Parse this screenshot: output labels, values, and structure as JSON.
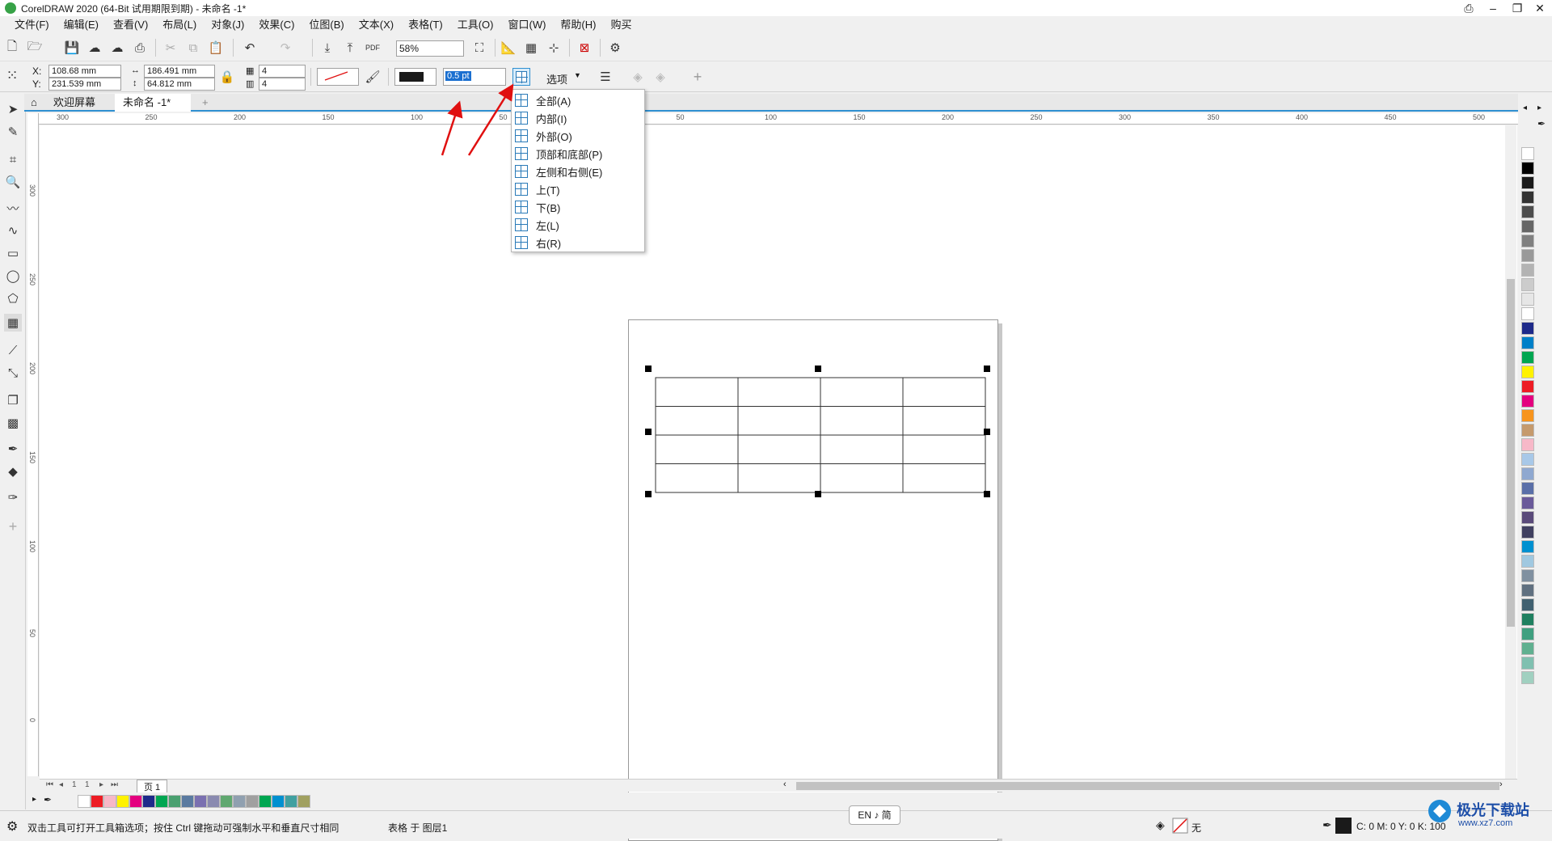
{
  "window": {
    "title": "CorelDRAW 2020 (64-Bit 试用期限到期) - 未命名 -1*",
    "minimize": "–",
    "maximize": "❐",
    "close": "✕"
  },
  "menu": [
    "文件(F)",
    "编辑(E)",
    "查看(V)",
    "布局(L)",
    "对象(J)",
    "效果(C)",
    "位图(B)",
    "文本(X)",
    "表格(T)",
    "工具(O)",
    "窗口(W)",
    "帮助(H)",
    "购买"
  ],
  "standard_toolbar": {
    "zoom_value": "58%"
  },
  "property_bar": {
    "x_label": "X:",
    "x_value": "108.68 mm",
    "y_label": "Y:",
    "y_value": "231.539 mm",
    "width_value": "186.491 mm",
    "height_value": "64.812 mm",
    "rows_value": "4",
    "cols_value": "4",
    "outline_width_value": "0.5 pt",
    "options_label": "选项"
  },
  "tabs": {
    "welcome": "欢迎屏幕",
    "document": "未命名 -1*"
  },
  "ruler_top_labels": [
    "300",
    "250",
    "200",
    "150",
    "100",
    "50",
    "0",
    "50",
    "100",
    "150",
    "200",
    "250",
    "300",
    "350",
    "400",
    "450",
    "500"
  ],
  "ruler_left_labels": [
    "300",
    "250",
    "200",
    "150",
    "100",
    "50",
    "0"
  ],
  "border_menu": {
    "items": [
      {
        "label": "全部(A)"
      },
      {
        "label": "内部(I)"
      },
      {
        "label": "外部(O)"
      },
      {
        "label": "顶部和底部(P)"
      },
      {
        "label": "左侧和右侧(E)"
      },
      {
        "label": "上(T)"
      },
      {
        "label": "下(B)"
      },
      {
        "label": "左(L)"
      },
      {
        "label": "右(R)"
      }
    ]
  },
  "table": {
    "rows": 4,
    "cols": 4
  },
  "page_nav": {
    "current": "1",
    "total": "1",
    "page_tab": "页 1"
  },
  "palette_colors": [
    "#ffffff",
    "#000000",
    "#1a1a1a",
    "#333333",
    "#4d4d4d",
    "#666666",
    "#808080",
    "#999999",
    "#b3b3b3",
    "#cccccc",
    "#e6e6e6",
    "#ffffff",
    "#1e2a8a",
    "#0080c8",
    "#00a651",
    "#fff200",
    "#ed1c24",
    "#e4007f",
    "#f7941d",
    "#c59a6d",
    "#f7b8c8",
    "#a8c8e8",
    "#8fa8d0",
    "#5a6fa8",
    "#6a5a9a",
    "#5a4a7a",
    "#404060",
    "#0090d0",
    "#a0c8e0",
    "#8090a0",
    "#607080",
    "#406070",
    "#208060",
    "#40a080",
    "#60b090",
    "#80c0b0",
    "#a0d0c0"
  ],
  "bottom_palette_colors": [
    "#ffffff",
    "#ed1c24",
    "#f7b8c8",
    "#fff200",
    "#e4007f",
    "#1e2a8a",
    "#00a651",
    "#4aa070",
    "#5a7aa0",
    "#7a70b0",
    "#8a8ab0",
    "#60a870",
    "#90a0b0",
    "#a0a0a0",
    "#00a651",
    "#0090d0",
    "#40a0a0",
    "#a0a060"
  ],
  "status": {
    "hint": "双击工具可打开工具箱选项；按住 Ctrl 键拖动可强制水平和垂直尺寸相同",
    "object_info": "表格 于 图层1",
    "fill_none": "无",
    "color_readout": "C: 0 M: 0 Y: 0 K: 100"
  },
  "ime": {
    "text": "EN ♪ 简"
  },
  "watermark": {
    "name": "极光下载站",
    "url": "www.xz7.com"
  },
  "colors": {
    "accent": "#2f8fd0",
    "selection": "#1a6fd0",
    "annotation_arrow": "#e01010"
  }
}
